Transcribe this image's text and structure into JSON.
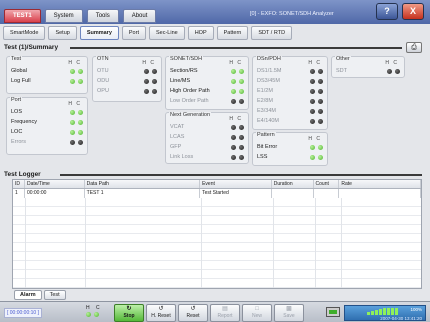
{
  "window": {
    "title": "[0] - EXFO: SONET/SDH Analyzer",
    "top_tabs": [
      "TEST1",
      "System",
      "Tools",
      "About"
    ],
    "help": "?",
    "close": "X"
  },
  "subtabs": [
    "SmartMode",
    "Setup",
    "Summary",
    "Port",
    "Sec-Line",
    "HOP",
    "Pattern",
    "SDT / RTD"
  ],
  "summary": {
    "title": "Test (1)/Summary",
    "hmc_h": "H",
    "hmc_c": "C",
    "test": {
      "title": "Test",
      "rows": [
        {
          "label": "Global",
          "h": "green",
          "c": "green"
        },
        {
          "label": "Log Full",
          "h": "green",
          "c": "green"
        }
      ]
    },
    "port": {
      "title": "Port",
      "rows": [
        {
          "label": "LOS",
          "h": "green",
          "c": "green"
        },
        {
          "label": "Frequency",
          "h": "green",
          "c": "green"
        },
        {
          "label": "LOC",
          "h": "green",
          "c": "green"
        },
        {
          "label": "Errors",
          "h": "black",
          "c": "black"
        }
      ]
    },
    "otn": {
      "title": "OTN",
      "rows": [
        {
          "label": "OTU",
          "h": "black",
          "c": "black"
        },
        {
          "label": "ODU",
          "h": "black",
          "c": "black"
        },
        {
          "label": "OPU",
          "h": "black",
          "c": "black"
        }
      ]
    },
    "sonet": {
      "title": "SONET/SDH",
      "rows": [
        {
          "label": "Section/RS",
          "h": "green",
          "c": "green"
        },
        {
          "label": "Line/MS",
          "h": "green",
          "c": "green"
        },
        {
          "label": "High Order Path",
          "h": "green",
          "c": "green"
        },
        {
          "label": "Low Order Path",
          "h": "black",
          "c": "black"
        }
      ]
    },
    "nextgen": {
      "title": "Next Generation",
      "rows": [
        {
          "label": "VCAT",
          "h": "black",
          "c": "black"
        },
        {
          "label": "LCAS",
          "h": "black",
          "c": "black"
        },
        {
          "label": "GFP",
          "h": "black",
          "c": "black"
        },
        {
          "label": "Link Loss",
          "h": "black",
          "c": "black"
        }
      ]
    },
    "dsn": {
      "title": "DSn/PDH",
      "rows": [
        {
          "label": "DS1/1.5M",
          "h": "black",
          "c": "black"
        },
        {
          "label": "DS3/45M",
          "h": "black",
          "c": "black"
        },
        {
          "label": "E1/2M",
          "h": "black",
          "c": "black"
        },
        {
          "label": "E2/8M",
          "h": "black",
          "c": "black"
        },
        {
          "label": "E3/34M",
          "h": "black",
          "c": "black"
        },
        {
          "label": "E4/140M",
          "h": "black",
          "c": "black"
        }
      ]
    },
    "pattern": {
      "title": "Pattern",
      "rows": [
        {
          "label": "Bit Error",
          "h": "green",
          "c": "green"
        },
        {
          "label": "LSS",
          "h": "green",
          "c": "green"
        }
      ]
    },
    "other": {
      "title": "Other",
      "rows": [
        {
          "label": "SDT",
          "h": "black",
          "c": "black"
        }
      ]
    }
  },
  "logger": {
    "title": "Test Logger",
    "columns": [
      "ID",
      "Date/Time",
      "Data Path",
      "Event",
      "Duration",
      "Count",
      "Rate"
    ],
    "rows": [
      [
        "1",
        "00:00:00",
        "TEST 1",
        "Test Started",
        "",
        "",
        ""
      ]
    ]
  },
  "bottom_tabs": [
    "Alarm",
    "Test"
  ],
  "status": {
    "elapsed": "[ 00:00:00:10 ]",
    "h": "H",
    "c": "C",
    "buttons": {
      "stop": "Stop",
      "h_reset": "H. Reset",
      "reset": "Reset",
      "report": "Report",
      "new": "New",
      "save": "Save"
    },
    "battery": "100%",
    "datetime": "2007-04-30 13:41:20"
  },
  "colors": {
    "titlebar": "#4f68a8",
    "active_tab": "#d9404c",
    "led_green": "#4fb52e",
    "led_black": "#1d1d1d",
    "stop_green": "#54b838"
  }
}
